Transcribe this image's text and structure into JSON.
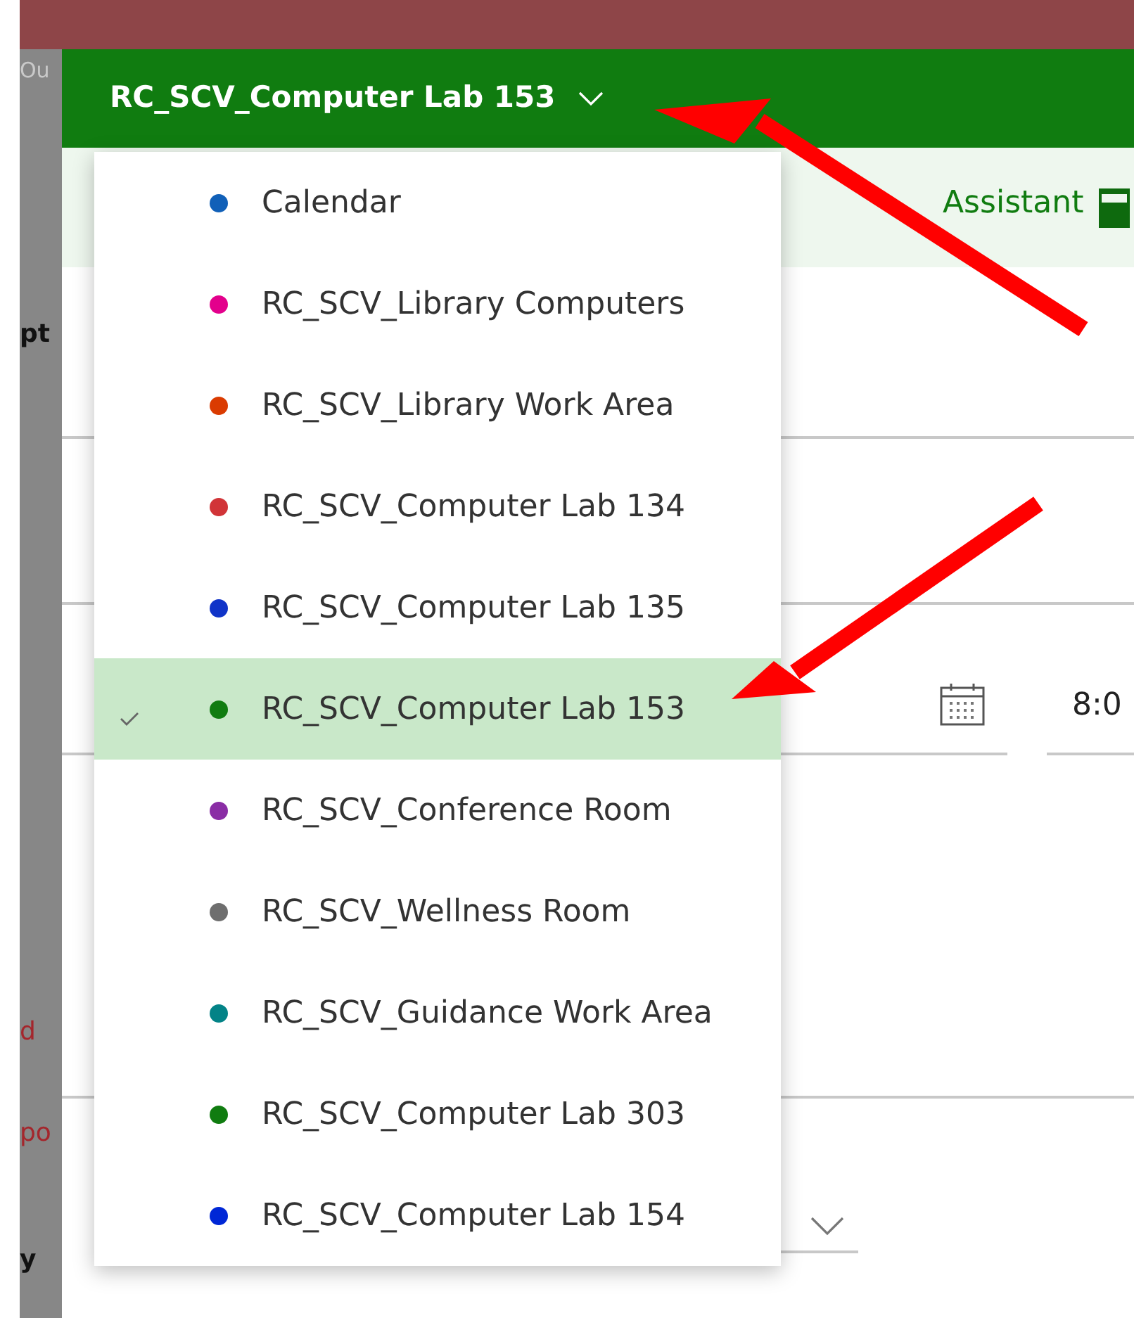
{
  "backdrop": {
    "fragments": [
      {
        "text": "Ou",
        "kind": "muted"
      },
      {
        "text": "pt",
        "kind": "bold"
      },
      {
        "text": "d",
        "kind": "link"
      },
      {
        "text": "po",
        "kind": "link"
      },
      {
        "text": "y",
        "kind": "bold"
      }
    ]
  },
  "header": {
    "title": "RC_SCV_Computer Lab 153"
  },
  "toolbar": {
    "label": "Assistant"
  },
  "form": {
    "time_value": "8:0"
  },
  "calendars": [
    {
      "name": "Calendar",
      "color": "#1160b8",
      "selected": false
    },
    {
      "name": "RC_SCV_Library Computers",
      "color": "#e3008c",
      "selected": false
    },
    {
      "name": "RC_SCV_Library Work Area",
      "color": "#da3b01",
      "selected": false
    },
    {
      "name": "RC_SCV_Computer Lab 134",
      "color": "#d13438",
      "selected": false
    },
    {
      "name": "RC_SCV_Computer Lab 135",
      "color": "#1034c8",
      "selected": false
    },
    {
      "name": "RC_SCV_Computer Lab 153",
      "color": "#107c10",
      "selected": true
    },
    {
      "name": "RC_SCV_Conference Room",
      "color": "#8a2da5",
      "selected": false
    },
    {
      "name": "RC_SCV_Wellness Room",
      "color": "#6e6e6e",
      "selected": false
    },
    {
      "name": "RC_SCV_Guidance Work Area",
      "color": "#038387",
      "selected": false
    },
    {
      "name": "RC_SCV_Computer Lab 303",
      "color": "#107c10",
      "selected": false
    },
    {
      "name": "RC_SCV_Computer Lab 154",
      "color": "#0027d6",
      "selected": false
    }
  ]
}
